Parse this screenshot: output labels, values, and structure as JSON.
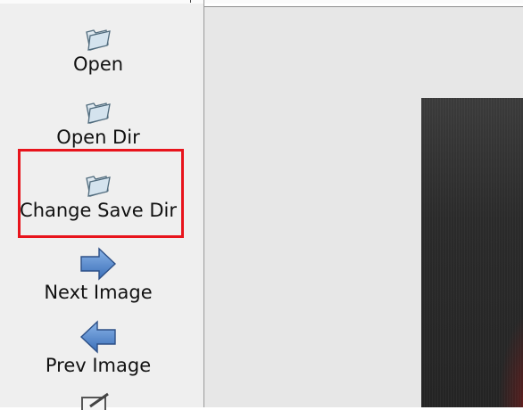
{
  "toolbar": {
    "open": {
      "label": "Open",
      "icon": "folder-open-icon"
    },
    "open_dir": {
      "label": "Open Dir",
      "icon": "folder-open-icon"
    },
    "change_save_dir": {
      "label": "Change Save Dir",
      "icon": "folder-open-icon"
    },
    "next_image": {
      "label": "Next Image",
      "icon": "arrow-right-icon"
    },
    "prev_image": {
      "label": "Prev Image",
      "icon": "arrow-left-icon"
    },
    "verify": {
      "icon": "check-edit-icon"
    }
  },
  "colors": {
    "highlight": "#e8141c",
    "sidebar_bg": "#efefef",
    "canvas_bg": "#e7e7e7"
  }
}
